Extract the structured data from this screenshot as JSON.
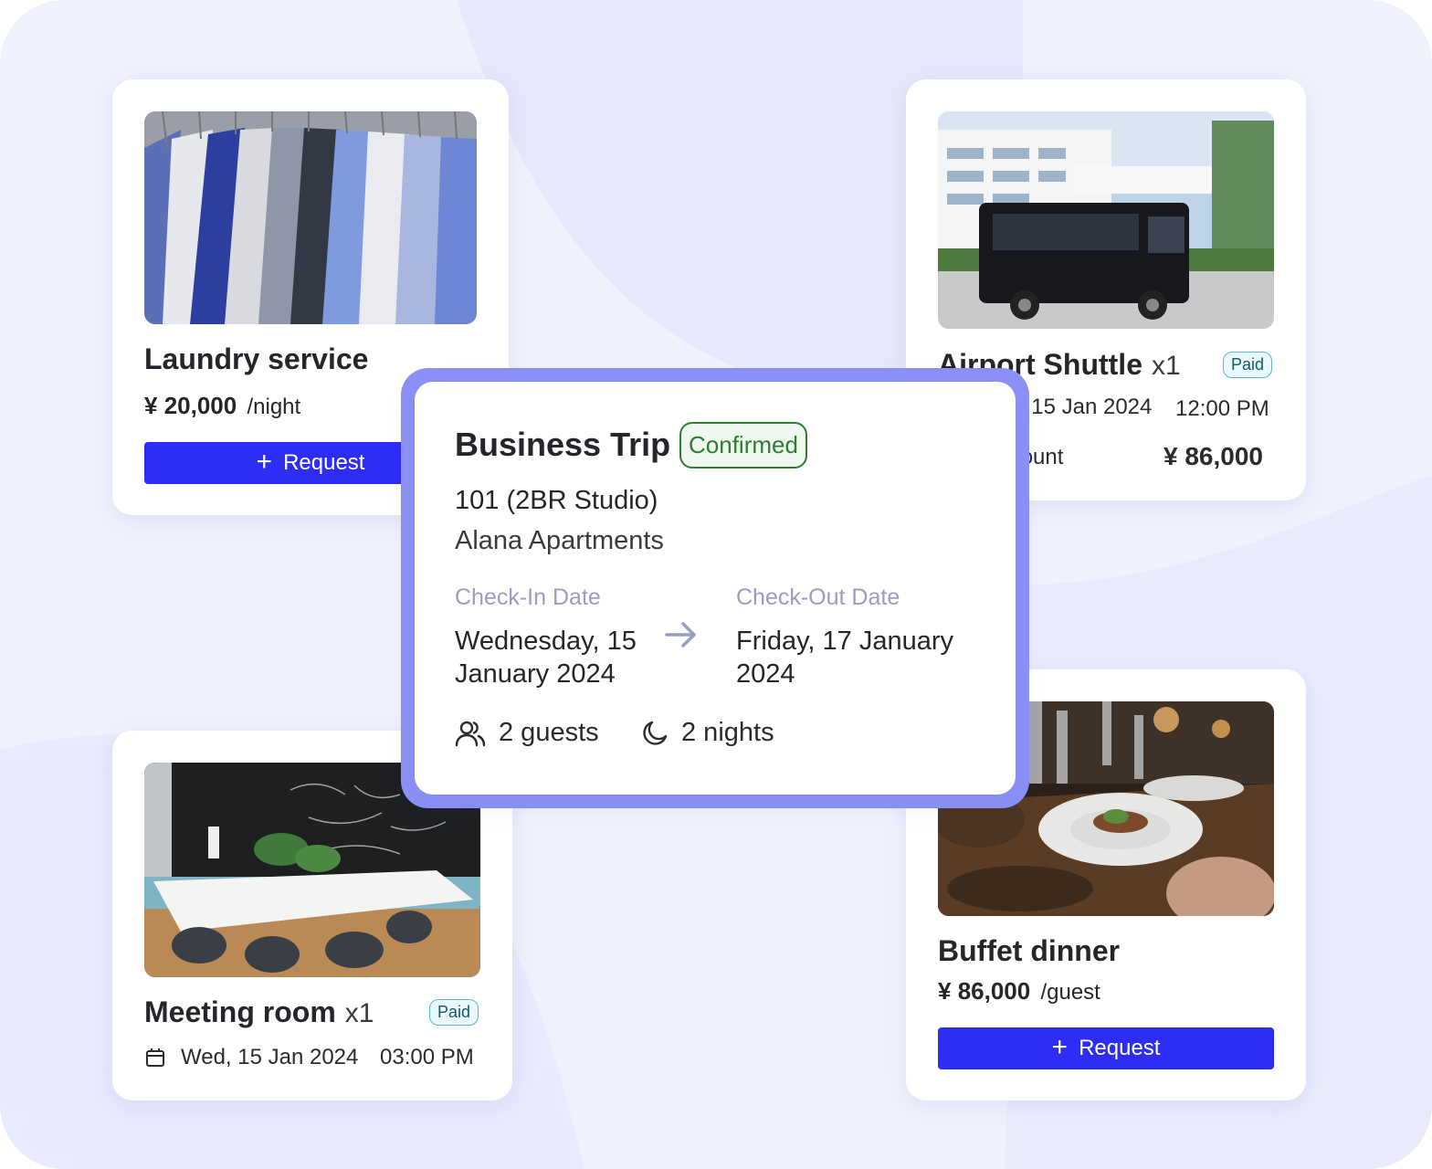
{
  "laundry": {
    "title": "Laundry service",
    "currency": "¥",
    "price": "20,000",
    "unit": "/night",
    "button": "Request",
    "image": "shirts-photo"
  },
  "shuttle": {
    "title": "Airport Shuttle",
    "qty": "x1",
    "badge": "Paid",
    "date": "Wed, 15 Jan 2024",
    "time": "12:00 PM",
    "total_label": "Total amount",
    "total_value": "¥ 86,000",
    "image": "shuttle-bus-photo"
  },
  "meeting": {
    "title": "Meeting room",
    "qty": "x1",
    "badge": "Paid",
    "date": "Wed, 15 Jan 2024",
    "time": "03:00 PM",
    "image": "meeting-room-photo"
  },
  "buffet": {
    "title": "Buffet dinner",
    "currency": "¥",
    "price": "86,000",
    "unit": "/guest",
    "button": "Request",
    "image": "dinner-table-photo"
  },
  "trip": {
    "title": "Business Trip",
    "status": "Confirmed",
    "room": "101 (2BR Studio)",
    "property": "Alana Apartments",
    "checkin_label": "Check-In Date",
    "checkin_line1": "Wednesday, 15",
    "checkin_line2": "January 2024",
    "checkout_label": "Check-Out Date",
    "checkout_line1": "Friday, 17 January",
    "checkout_line2": "2024",
    "guests": "2 guests",
    "nights": "2 nights"
  },
  "colors": {
    "accent": "#2d2df5",
    "confirmed": "#2e7d32",
    "paid": "#14596b",
    "muted_label": "#9a9cc4",
    "frame": "#8c91f8"
  }
}
